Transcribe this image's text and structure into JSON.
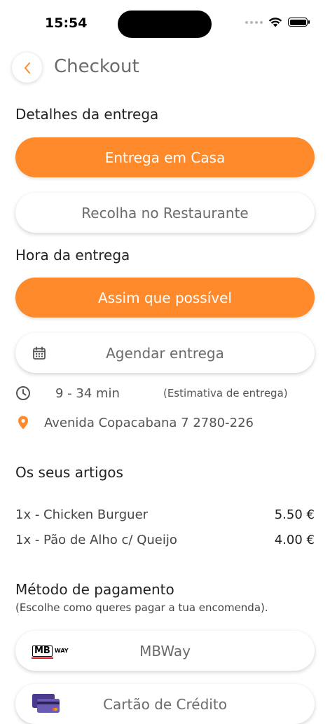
{
  "status_bar": {
    "time": "15:54"
  },
  "header": {
    "title": "Checkout"
  },
  "delivery": {
    "section_label": "Detalhes da entrega",
    "options": [
      {
        "label": "Entrega em Casa",
        "selected": true
      },
      {
        "label": "Recolha no Restaurante",
        "selected": false
      }
    ]
  },
  "delivery_time": {
    "section_label": "Hora da entrega",
    "options": [
      {
        "label": "Assim que possível",
        "selected": true
      },
      {
        "label": "Agendar entrega",
        "selected": false,
        "icon": "calendar-icon"
      }
    ],
    "estimate": "9 - 34 min",
    "estimate_note": "(Estimativa de entrega)",
    "address": "Avenida Copacabana 7 2780-226"
  },
  "items": {
    "section_label": "Os seus artigos",
    "list": [
      {
        "name": "1x - Chicken Burguer",
        "price": "5.50 €"
      },
      {
        "name": "1x - Pão de Alho c/ Queijo",
        "price": "4.00 €"
      }
    ]
  },
  "payment": {
    "section_label": "Método de pagamento",
    "subtitle": "(Escolhe como queres pagar a tua encomenda).",
    "methods": [
      {
        "label": "MBWay",
        "icon": "mbway-logo",
        "logo_text_mb": "MB",
        "logo_text_way": "WAY"
      },
      {
        "label": "Cartão de Crédito",
        "icon": "credit-card-icon"
      }
    ]
  },
  "colors": {
    "accent": "#ff8a2b",
    "text": "#222222",
    "muted": "#6b6b6b"
  }
}
